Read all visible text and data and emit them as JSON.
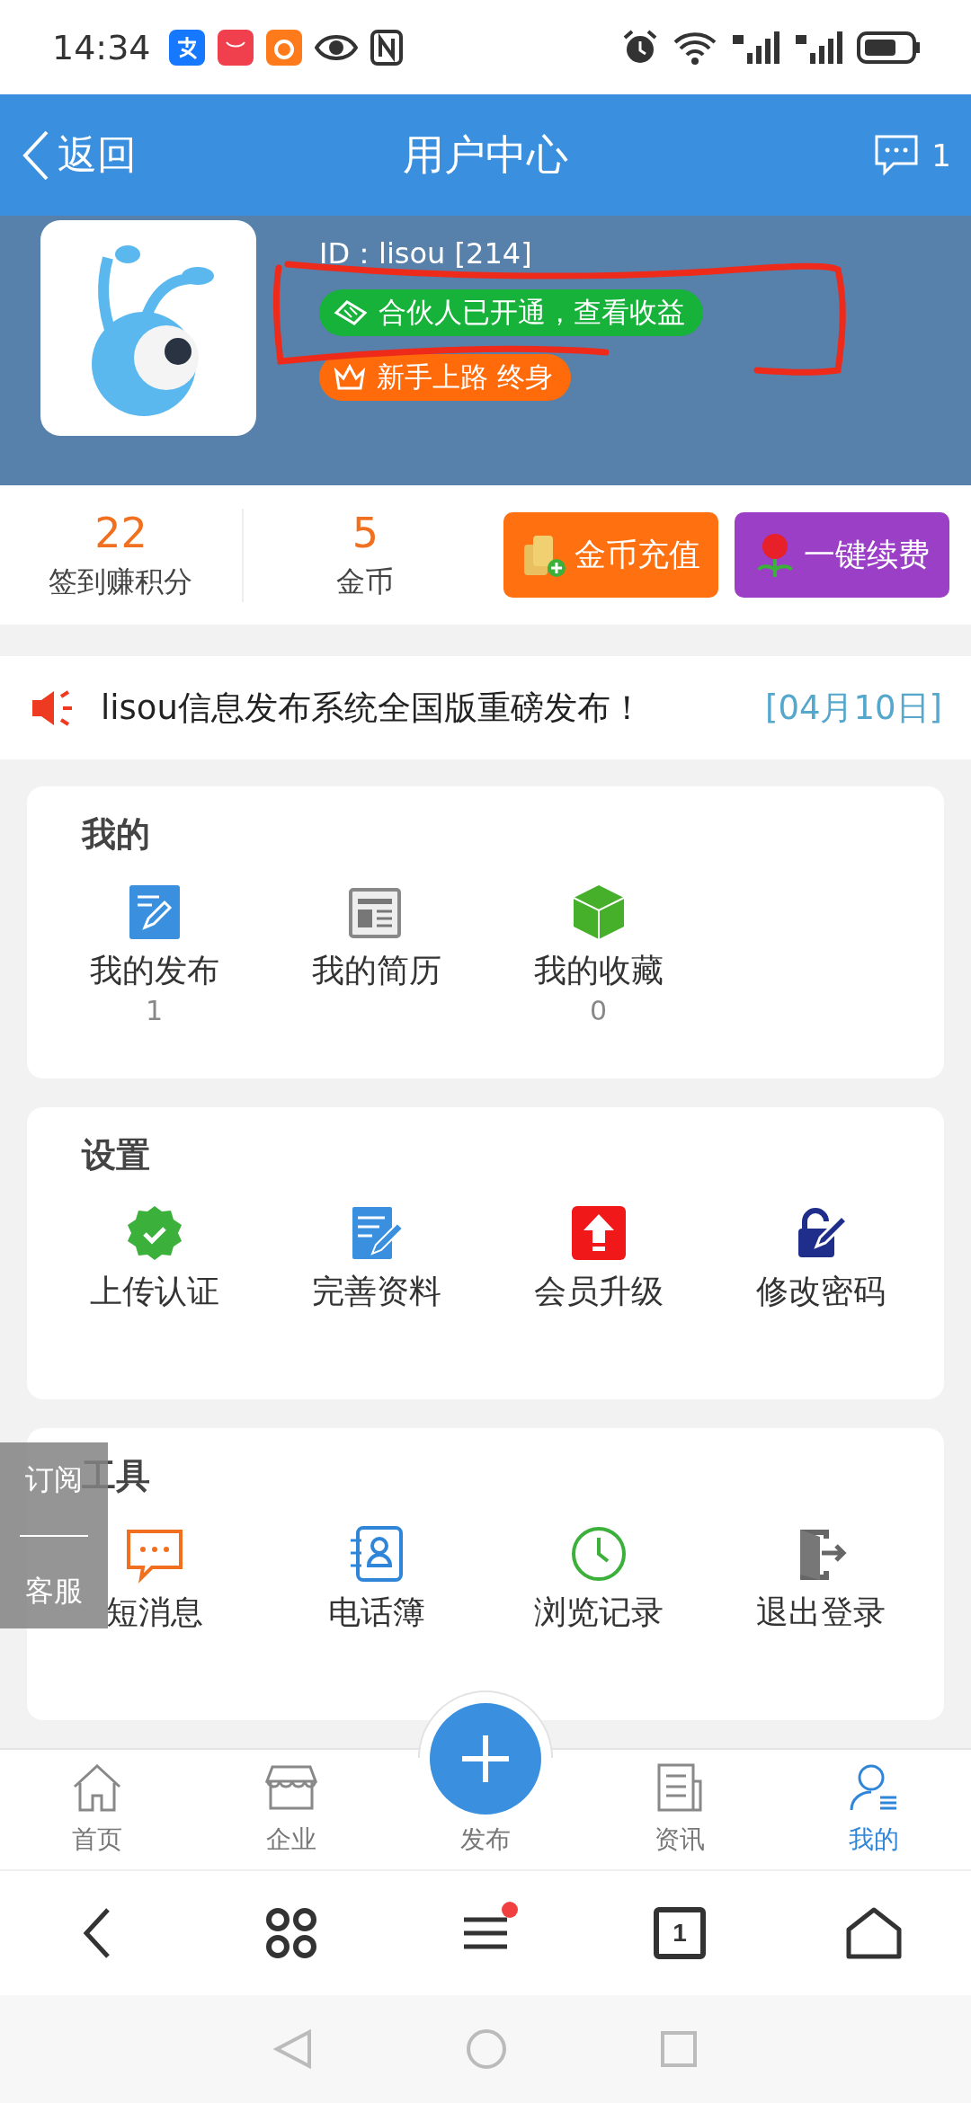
{
  "status_bar": {
    "time": "14:34"
  },
  "header": {
    "back_label": "返回",
    "title": "用户中心",
    "message_count": "1"
  },
  "profile": {
    "id_text": "ID：lisou [214]",
    "partner_badge": "合伙人已开通，查看收益",
    "level_badge": "新手上路 终身"
  },
  "stats": [
    {
      "value": "22",
      "label": "签到赚积分"
    },
    {
      "value": "5",
      "label": "金币"
    }
  ],
  "action_buttons": [
    {
      "kind": "coins",
      "label": "金币充值",
      "color": "#ff7010"
    },
    {
      "kind": "flower",
      "label": "一键续费",
      "color": "#9a3fc6"
    }
  ],
  "notice": {
    "text": "lisou信息发布系统全国版重磅发布！",
    "date": "[04月10日]"
  },
  "sections": [
    {
      "title": "我的",
      "items": [
        {
          "kind": "publish",
          "label": "我的发布",
          "count": "1"
        },
        {
          "kind": "resume",
          "label": "我的简历"
        },
        {
          "kind": "favorite",
          "label": "我的收藏",
          "count": "0"
        }
      ]
    },
    {
      "title": "设置",
      "items": [
        {
          "kind": "verify",
          "label": "上传认证"
        },
        {
          "kind": "profile",
          "label": "完善资料"
        },
        {
          "kind": "upgrade",
          "label": "会员升级"
        },
        {
          "kind": "password",
          "label": "修改密码"
        }
      ]
    },
    {
      "title": "工具",
      "items": [
        {
          "kind": "sms",
          "label": "短消息"
        },
        {
          "kind": "contacts",
          "label": "电话簿"
        },
        {
          "kind": "history",
          "label": "浏览记录"
        },
        {
          "kind": "logout",
          "label": "退出登录"
        }
      ]
    }
  ],
  "side_float": [
    "订阅",
    "客服"
  ],
  "bottom_nav": [
    {
      "kind": "home",
      "label": "首页",
      "selected": false
    },
    {
      "kind": "shop",
      "label": "企业",
      "selected": false
    },
    {
      "kind": "publish",
      "label": "发布",
      "selected": false
    },
    {
      "kind": "news",
      "label": "资讯",
      "selected": false
    },
    {
      "kind": "user",
      "label": "我的",
      "selected": true
    }
  ],
  "browser_bar": {
    "tab_count": "1",
    "menu_badge": true
  }
}
